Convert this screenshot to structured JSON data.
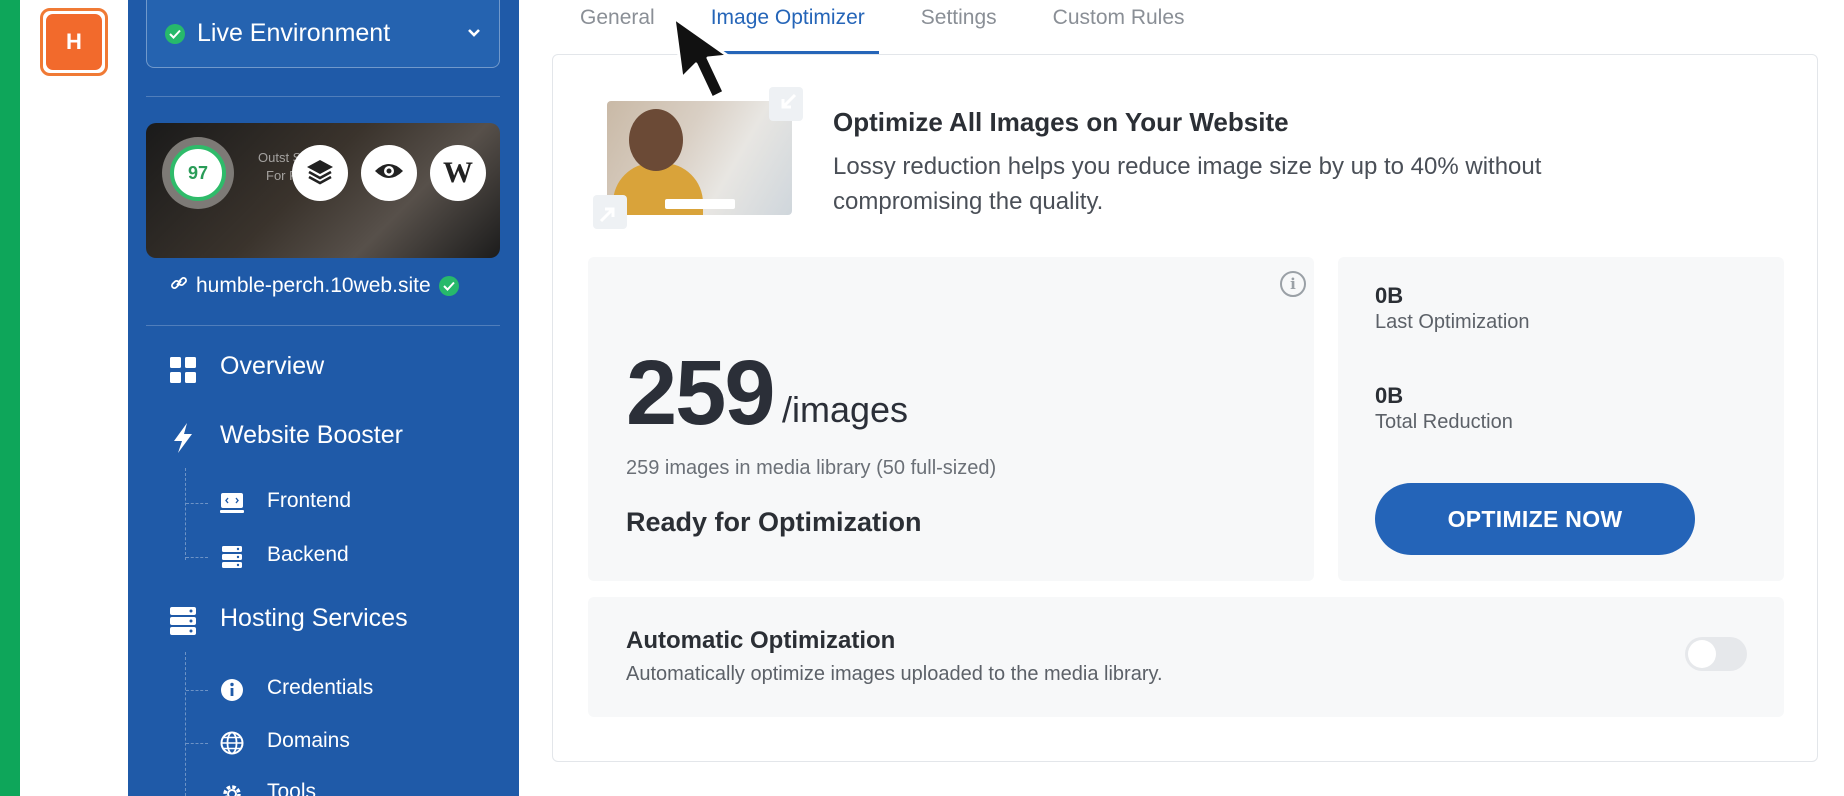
{
  "rail": {
    "avatar_letter": "H"
  },
  "sidebar": {
    "environment": "Live Environment",
    "preview": {
      "score": "97",
      "overlay_text_1": "Outst Stu",
      "overlay_text_2": "For Fi"
    },
    "site_url": "humble-perch.10web.site",
    "items": [
      {
        "label": "Overview",
        "icon": "grid-icon"
      },
      {
        "label": "Website Booster",
        "icon": "bolt-icon"
      },
      {
        "label": "Frontend",
        "icon": "code-window-icon"
      },
      {
        "label": "Backend",
        "icon": "server-icon"
      },
      {
        "label": "Hosting Services",
        "icon": "server-stack-icon"
      },
      {
        "label": "Credentials",
        "icon": "info-circle-icon"
      },
      {
        "label": "Domains",
        "icon": "globe-icon"
      },
      {
        "label": "Tools",
        "icon": "gear-icon"
      }
    ]
  },
  "tabs": [
    "General",
    "Image Optimizer",
    "Settings",
    "Custom Rules"
  ],
  "active_tab": "Image Optimizer",
  "hero": {
    "title": "Optimize All Images on Your Website",
    "description": "Lossy reduction helps you reduce image size by up to 40% without compromising the quality."
  },
  "stats": {
    "count": "259",
    "unit": "/images",
    "library_text": "259 images in media library (50 full-sized)",
    "status": "Ready for Optimization"
  },
  "summary": {
    "last_value": "0B",
    "last_label": "Last Optimization",
    "total_value": "0B",
    "total_label": "Total Reduction",
    "button": "OPTIMIZE NOW"
  },
  "auto": {
    "title": "Automatic Optimization",
    "description": "Automatically optimize images uploaded to the media library.",
    "enabled": false
  },
  "colors": {
    "accent": "#2464b8",
    "sidebar": "#1f5aa8",
    "success": "#27b96b",
    "brand_orange": "#f26a2c",
    "strip_green": "#0ea65a"
  }
}
